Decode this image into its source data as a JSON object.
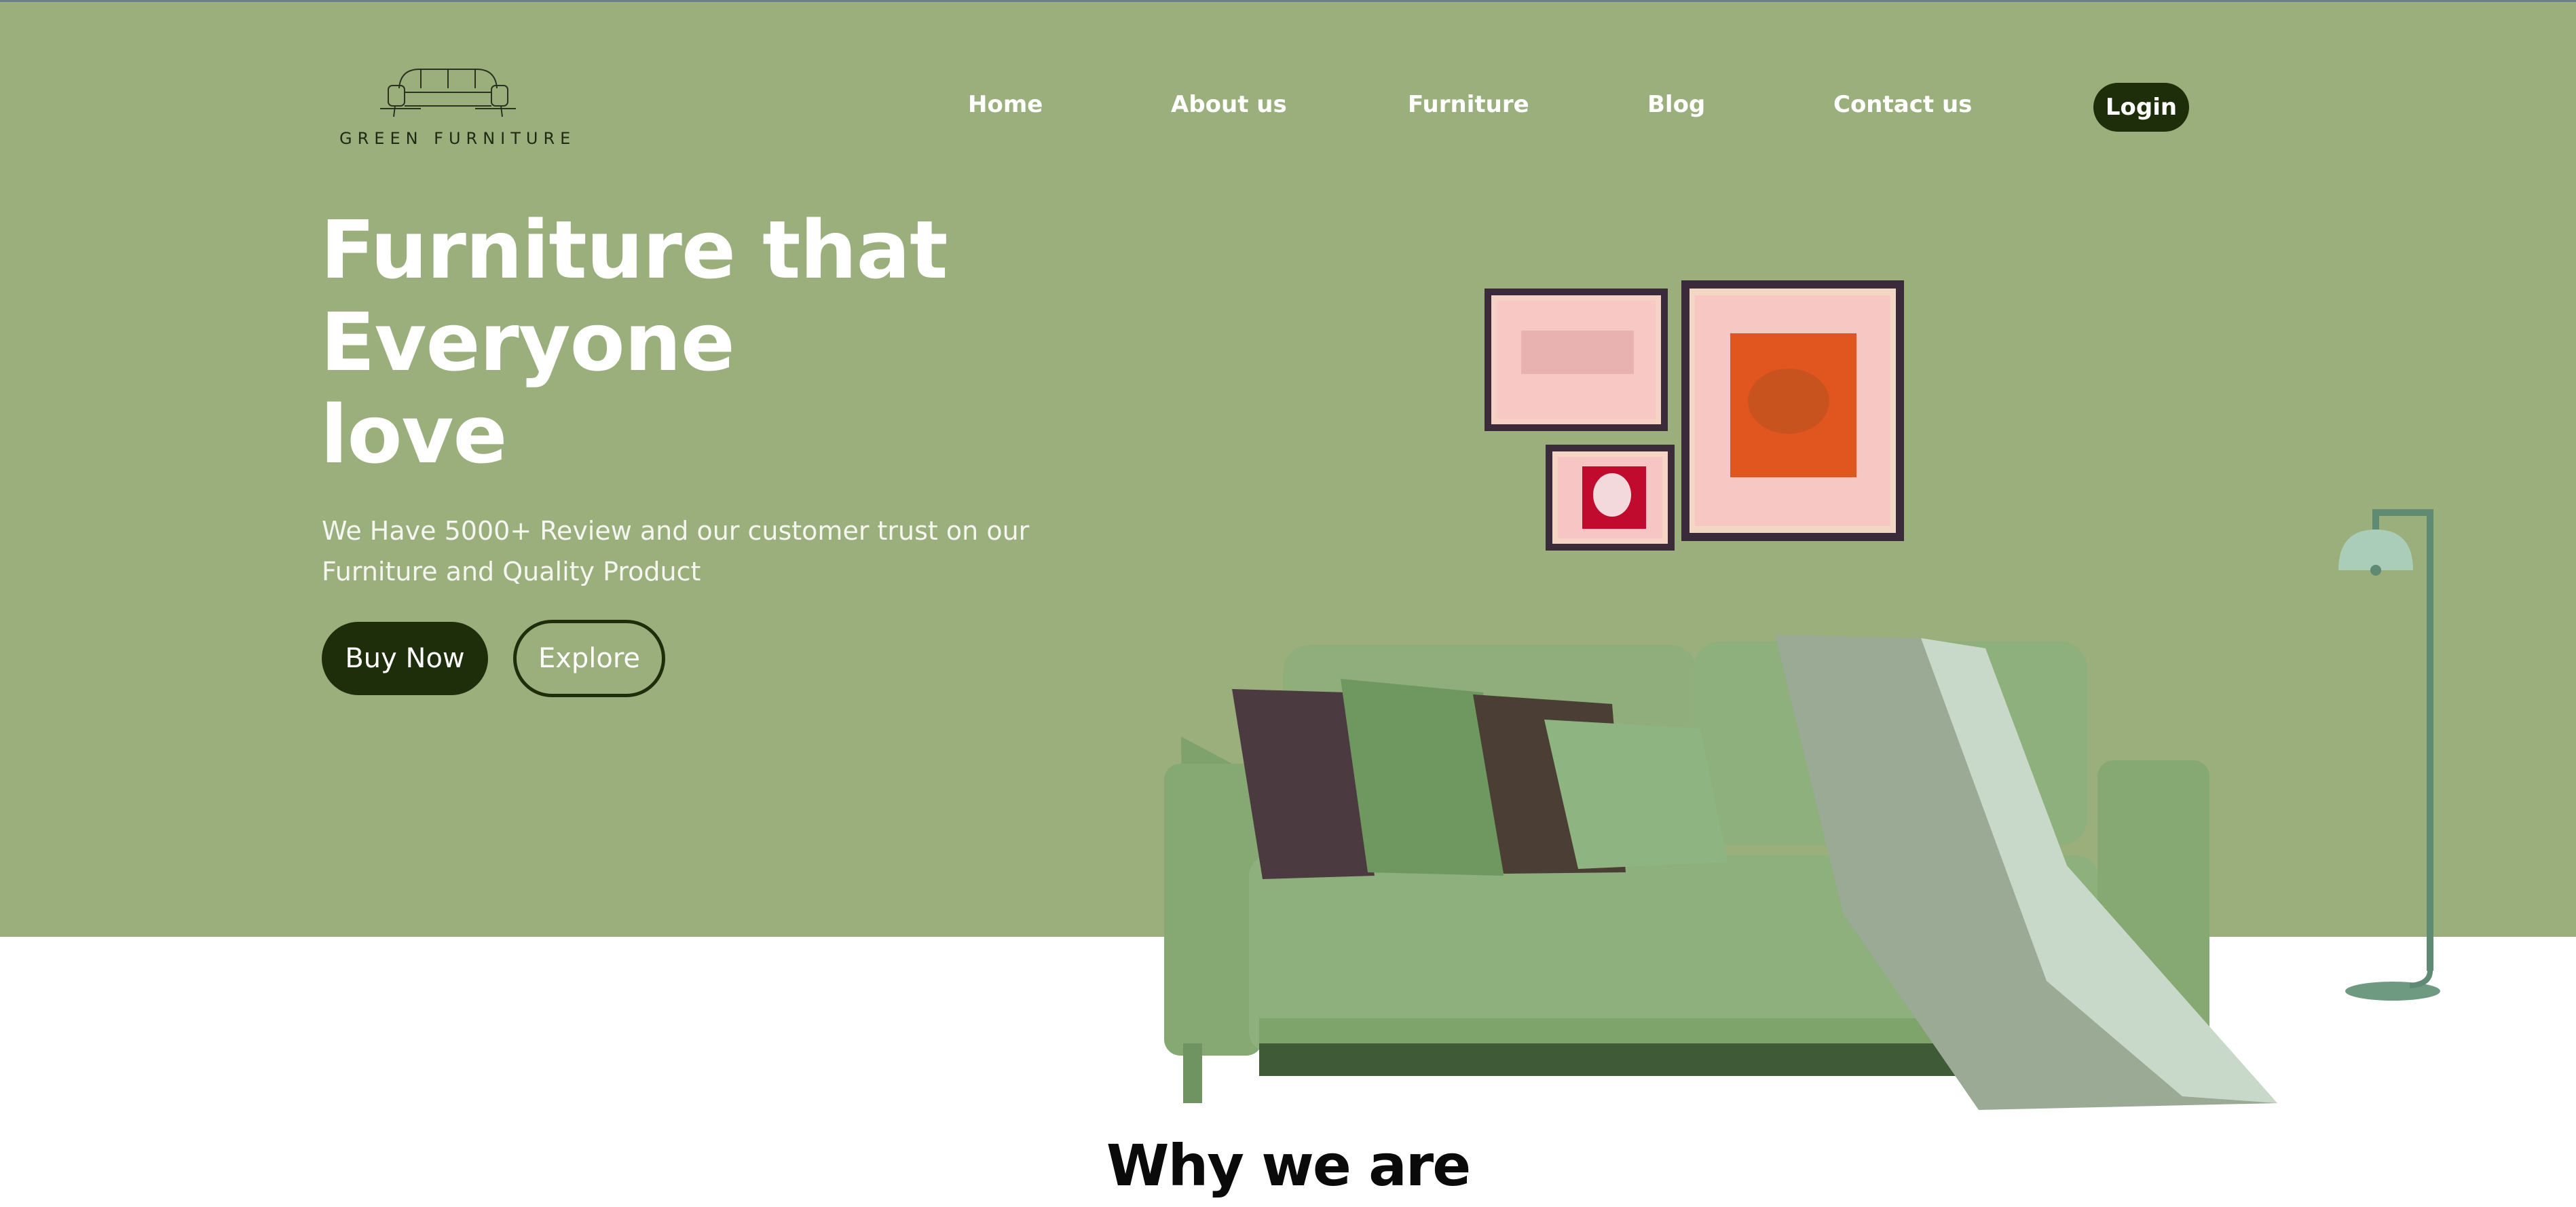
{
  "brand": {
    "logo_text": "GREEN FURNITURE",
    "logo_icon": "sofa-outline-icon"
  },
  "nav": {
    "items": [
      {
        "label": "Home"
      },
      {
        "label": "About us"
      },
      {
        "label": "Furniture"
      },
      {
        "label": "Blog"
      },
      {
        "label": "Contact us"
      }
    ],
    "login_label": "Login"
  },
  "hero": {
    "title_lines": [
      "Furniture that",
      "Everyone",
      "love"
    ],
    "subtitle_lines": [
      "We Have 5000+ Review and our customer trust on our",
      "Furniture and Quality Product"
    ],
    "buy_label": "Buy Now",
    "explore_label": "Explore"
  },
  "illustration": {
    "items": [
      "picture-frames",
      "green-sofa",
      "floor-lamp"
    ]
  },
  "section": {
    "title": "Why we are"
  },
  "colors": {
    "hero_background": "#9aaf7c",
    "accent_dark": "#1e2e0a",
    "text_light": "#ffffff",
    "page_background": "#ffffff"
  }
}
